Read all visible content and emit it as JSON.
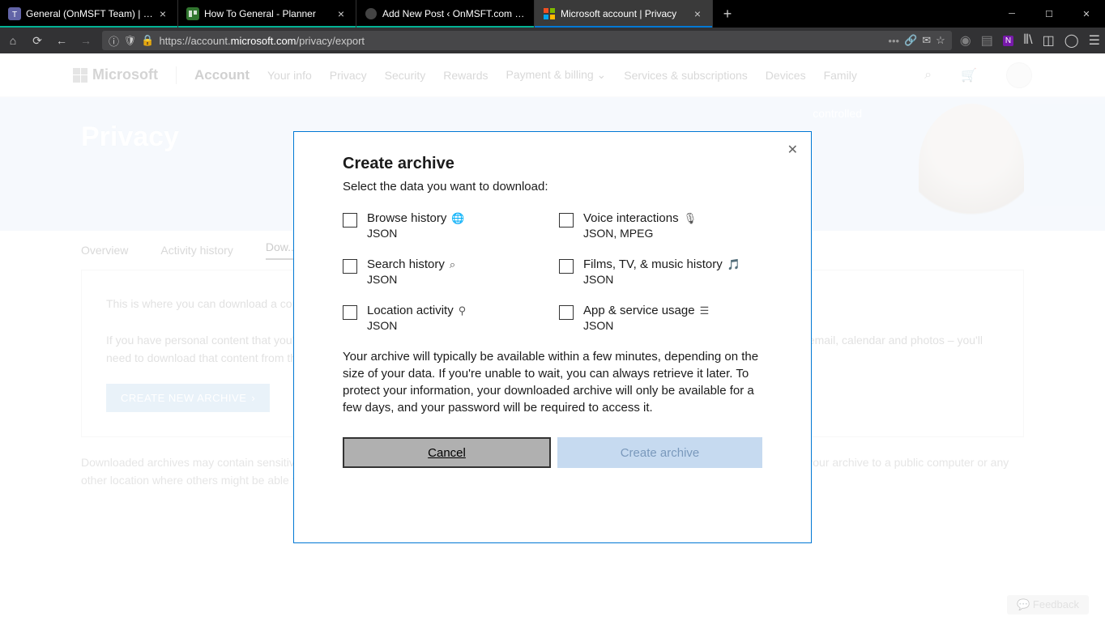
{
  "browser": {
    "tabs": [
      {
        "title": "General (OnMSFT Team) | Micr"
      },
      {
        "title": "How To General - Planner"
      },
      {
        "title": "Add New Post ‹ OnMSFT.com — W"
      },
      {
        "title": "Microsoft account | Privacy"
      }
    ],
    "url": "https://account.microsoft.com/privacy/export",
    "url_prefix": "https://account.",
    "url_bold": "microsoft.com",
    "url_suffix": "/privacy/export"
  },
  "header": {
    "brand": "Microsoft",
    "account": "Account",
    "nav": [
      "Your info",
      "Privacy",
      "Security",
      "Rewards",
      "Payment & billing",
      "Services & subscriptions",
      "Devices",
      "Family"
    ]
  },
  "hero": {
    "title": "Privacy",
    "tagline": "controlled"
  },
  "tabs": {
    "items": [
      "Overview",
      "Activity history",
      "Dow..."
    ]
  },
  "content": {
    "p1": "This is where you can download a copy of your privacy data. If you just want to view your data, you can do so from the activity history page.",
    "p2": "If you have personal content that you've saved or shared using other Microsoft products – like documents you've saved to OneDrive or your email, calendar and photos – you'll need to download that content from those products.",
    "btn": "CREATE NEW ARCHIVE"
  },
  "footnote": "Downloaded archives may contain sensitive content, such as your search history, location information and other personal data. Do not download your archive to a public computer or any other location where others might be able to access it.",
  "feedback": "Feedback",
  "modal": {
    "title": "Create archive",
    "subtitle": "Select the data you want to download:",
    "options": [
      {
        "label": "Browse history",
        "fmt": "JSON",
        "icon": "globe"
      },
      {
        "label": "Voice interactions",
        "fmt": "JSON, MPEG",
        "icon": "mic"
      },
      {
        "label": "Search history",
        "fmt": "JSON",
        "icon": "search"
      },
      {
        "label": "Films, TV, & music history",
        "fmt": "JSON",
        "icon": "media"
      },
      {
        "label": "Location activity",
        "fmt": "JSON",
        "icon": "location"
      },
      {
        "label": "App & service usage",
        "fmt": "JSON",
        "icon": "list"
      }
    ],
    "info": "Your archive will typically be available within a few minutes, depending on the size of your data. If you're unable to wait, you can always retrieve it later. To protect your information, your downloaded archive will only be available for a few days, and your password will be required to access it.",
    "cancel": "Cancel",
    "create": "Create archive"
  }
}
